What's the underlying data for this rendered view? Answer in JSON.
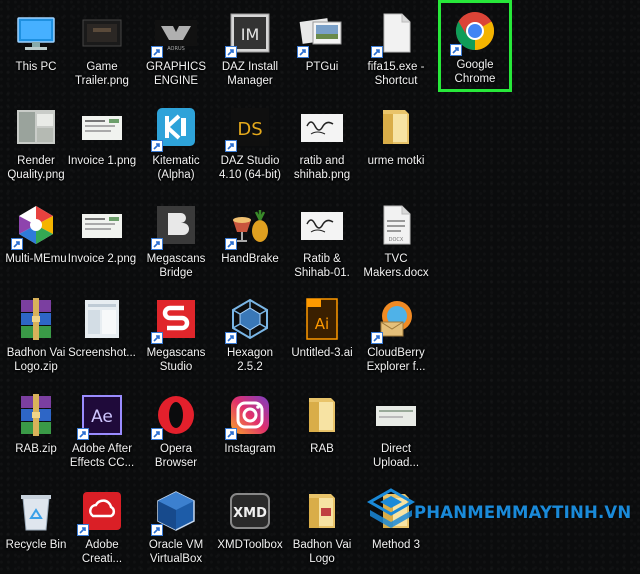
{
  "desktop": {
    "icons": [
      {
        "label": "This PC",
        "icon": "this-pc-icon",
        "shortcut": false
      },
      {
        "label": "Game\nTrailer.png",
        "icon": "image-file-icon",
        "shortcut": false
      },
      {
        "label": "GRAPHICS\nENGINE",
        "icon": "graphics-engine-icon",
        "shortcut": true
      },
      {
        "label": "DAZ Install\nManager",
        "icon": "daz-install-manager-icon",
        "shortcut": true
      },
      {
        "label": "PTGui",
        "icon": "ptgui-icon",
        "shortcut": true
      },
      {
        "label": "fifa15.exe -\nShortcut",
        "icon": "blank-file-icon",
        "shortcut": true
      },
      {
        "label": "Google\nChrome",
        "icon": "chrome-icon",
        "shortcut": true,
        "highlighted": true
      },
      {
        "label": "Render\nQuality.png",
        "icon": "image-file-icon",
        "shortcut": false
      },
      {
        "label": "Invoice 1.png",
        "icon": "image-file-icon",
        "shortcut": false
      },
      {
        "label": "Kitematic\n(Alpha)",
        "icon": "kitematic-icon",
        "shortcut": true
      },
      {
        "label": "DAZ Studio\n4.10 (64-bit)",
        "icon": "daz-studio-icon",
        "shortcut": true
      },
      {
        "label": "ratib and\nshihab.png",
        "icon": "image-file-icon",
        "shortcut": false
      },
      {
        "label": "urme motki",
        "icon": "folder-icon",
        "shortcut": false
      },
      {
        "label": "Multi-MEmu",
        "icon": "memu-icon",
        "shortcut": true
      },
      {
        "label": "Invoice 2.png",
        "icon": "image-file-icon",
        "shortcut": false
      },
      {
        "label": "Megascans\nBridge",
        "icon": "megascans-bridge-icon",
        "shortcut": true
      },
      {
        "label": "HandBrake",
        "icon": "handbrake-icon",
        "shortcut": true
      },
      {
        "label": "Ratib &\nShihab-01.",
        "icon": "image-file-icon",
        "shortcut": false
      },
      {
        "label": "TVC\nMakers.docx",
        "icon": "docx-file-icon",
        "shortcut": false
      },
      {
        "label": "Badhon Vai\nLogo.zip",
        "icon": "winrar-icon",
        "shortcut": false
      },
      {
        "label": "Screenshot...",
        "icon": "image-file-icon",
        "shortcut": false
      },
      {
        "label": "Megascans\nStudio",
        "icon": "megascans-studio-icon",
        "shortcut": true
      },
      {
        "label": "Hexagon\n2.5.2",
        "icon": "hexagon-icon",
        "shortcut": true
      },
      {
        "label": "Untitled-3.ai",
        "icon": "illustrator-file-icon",
        "shortcut": false
      },
      {
        "label": "CloudBerry\nExplorer f...",
        "icon": "cloudberry-icon",
        "shortcut": true
      },
      {
        "label": "RAB.zip",
        "icon": "winrar-icon",
        "shortcut": false
      },
      {
        "label": "Adobe After\nEffects CC...",
        "icon": "after-effects-icon",
        "shortcut": true
      },
      {
        "label": "Opera\nBrowser",
        "icon": "opera-icon",
        "shortcut": true
      },
      {
        "label": "Instagram",
        "icon": "instagram-icon",
        "shortcut": true
      },
      {
        "label": "RAB",
        "icon": "folder-icon",
        "shortcut": false
      },
      {
        "label": "Direct\nUpload...",
        "icon": "image-file-icon",
        "shortcut": false
      },
      {
        "label": "Recycle Bin",
        "icon": "recycle-bin-icon",
        "shortcut": false
      },
      {
        "label": "Adobe\nCreati...",
        "icon": "creative-cloud-icon",
        "shortcut": true
      },
      {
        "label": "Oracle VM\nVirtualBox",
        "icon": "virtualbox-icon",
        "shortcut": true
      },
      {
        "label": "XMDToolbox",
        "icon": "xmd-toolbox-icon",
        "shortcut": false
      },
      {
        "label": "Badhon Vai\nLogo",
        "icon": "folder-icon",
        "shortcut": false
      },
      {
        "label": "Method 3",
        "icon": "folder-icon",
        "shortcut": false
      }
    ]
  },
  "watermark": {
    "text": "PHANMEMMAYTINH.VN",
    "icon": "phanmem-logo-icon"
  },
  "colors": {
    "highlight": "#27e83a",
    "watermark": "#1a8ad9",
    "background": "#0b0c0d"
  }
}
